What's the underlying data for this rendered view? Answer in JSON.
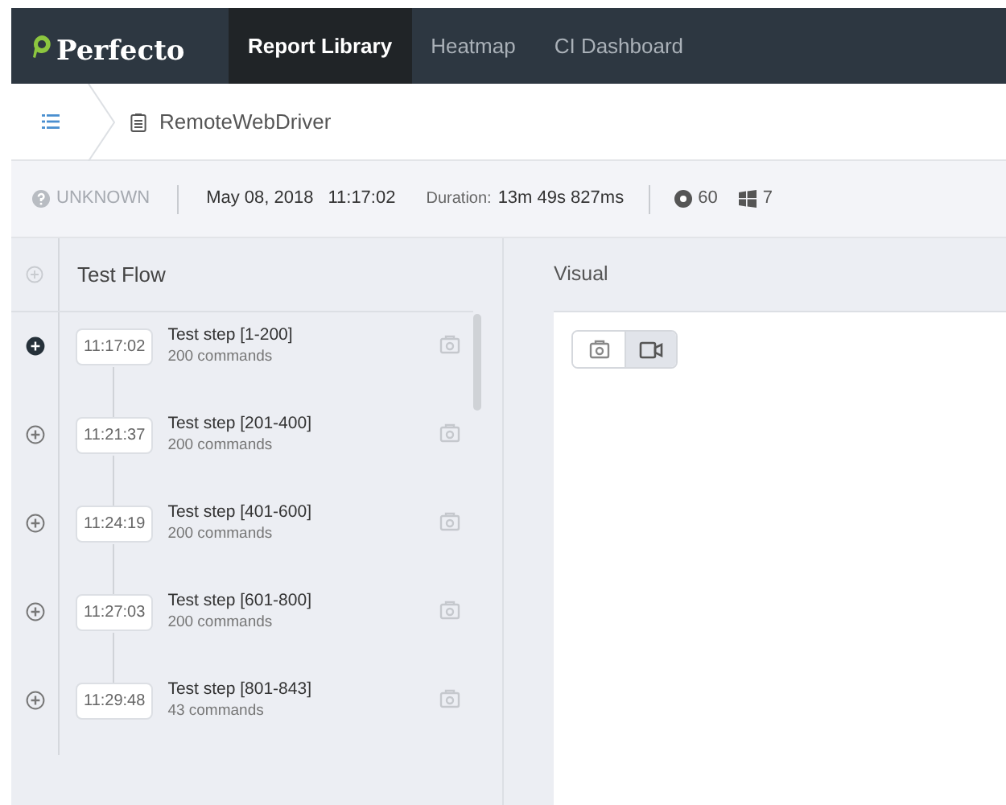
{
  "nav": {
    "logo": "Perfecto",
    "tabs": [
      {
        "label": "Report Library",
        "selected": true
      },
      {
        "label": "Heatmap",
        "selected": false
      },
      {
        "label": "CI Dashboard",
        "selected": false
      }
    ]
  },
  "breadcrumb": {
    "title": "RemoteWebDriver"
  },
  "info": {
    "status": "UNKNOWN",
    "date": "May 08, 2018",
    "time": "11:17:02",
    "duration_label": "Duration:",
    "duration": "13m 49s 827ms",
    "browser_version": "60",
    "os_version": "7"
  },
  "test_flow": {
    "title": "Test Flow",
    "steps": [
      {
        "time": "11:17:02",
        "name": "Test step [1-200]",
        "commands": "200 commands",
        "selected": true
      },
      {
        "time": "11:21:37",
        "name": "Test step [201-400]",
        "commands": "200 commands",
        "selected": false
      },
      {
        "time": "11:24:19",
        "name": "Test step [401-600]",
        "commands": "200 commands",
        "selected": false
      },
      {
        "time": "11:27:03",
        "name": "Test step [601-800]",
        "commands": "200 commands",
        "selected": false
      },
      {
        "time": "11:29:48",
        "name": "Test step [801-843]",
        "commands": "43 commands",
        "selected": false
      }
    ]
  },
  "visual": {
    "title": "Visual",
    "modes": [
      {
        "kind": "screenshot",
        "selected": false
      },
      {
        "kind": "video",
        "selected": true
      }
    ]
  }
}
